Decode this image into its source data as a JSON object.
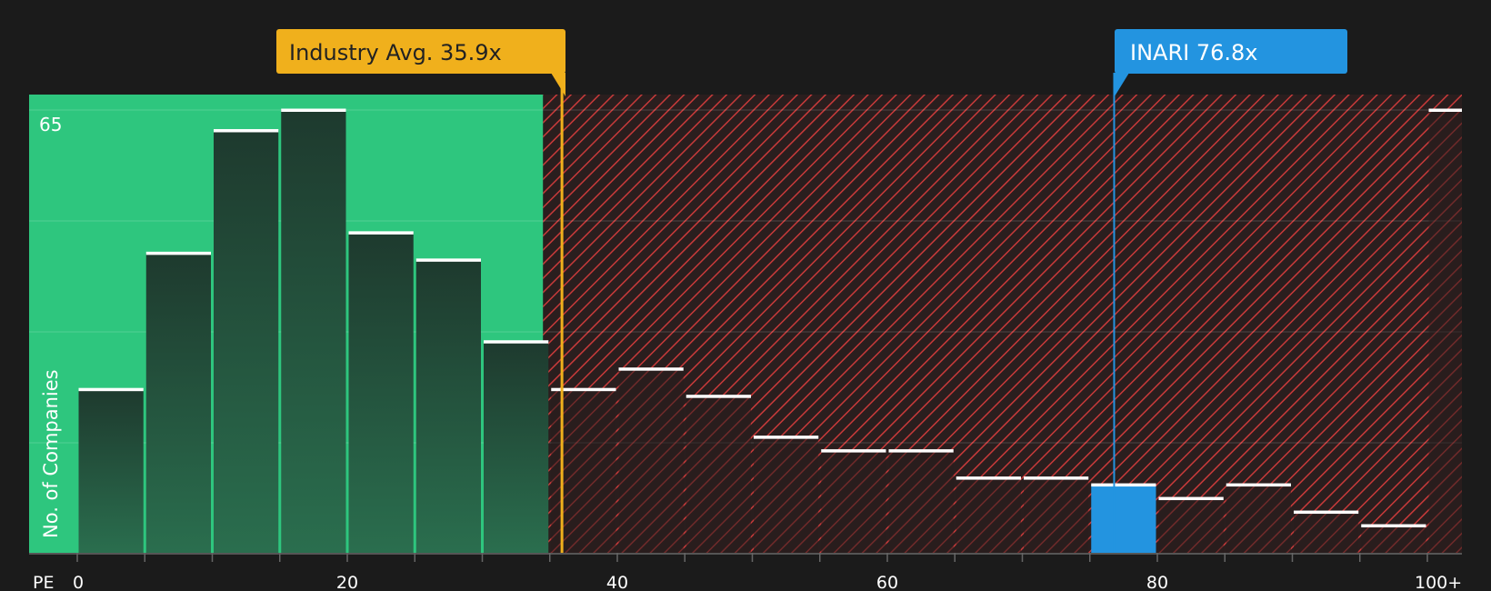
{
  "chart_data": {
    "type": "bar",
    "x_tick_prefix": "PE",
    "x_ticks": [
      "0",
      "20",
      "40",
      "60",
      "80",
      "100+"
    ],
    "y_tick_top": "65",
    "ylabel": "No. of Companies",
    "bins": [
      {
        "range": [
          0,
          5
        ],
        "value": 24,
        "highlight": false
      },
      {
        "range": [
          5,
          10
        ],
        "value": 44,
        "highlight": false
      },
      {
        "range": [
          10,
          15
        ],
        "value": 62,
        "highlight": false
      },
      {
        "range": [
          15,
          20
        ],
        "value": 65,
        "highlight": false
      },
      {
        "range": [
          20,
          25
        ],
        "value": 47,
        "highlight": false
      },
      {
        "range": [
          25,
          30
        ],
        "value": 43,
        "highlight": false
      },
      {
        "range": [
          30,
          35
        ],
        "value": 31,
        "highlight": false
      },
      {
        "range": [
          35,
          40
        ],
        "value": 24,
        "highlight": false
      },
      {
        "range": [
          40,
          45
        ],
        "value": 27,
        "highlight": false
      },
      {
        "range": [
          45,
          50
        ],
        "value": 23,
        "highlight": false
      },
      {
        "range": [
          50,
          55
        ],
        "value": 17,
        "highlight": false
      },
      {
        "range": [
          55,
          60
        ],
        "value": 15,
        "highlight": false
      },
      {
        "range": [
          60,
          65
        ],
        "value": 15,
        "highlight": false
      },
      {
        "range": [
          65,
          70
        ],
        "value": 11,
        "highlight": false
      },
      {
        "range": [
          70,
          75
        ],
        "value": 11,
        "highlight": false
      },
      {
        "range": [
          75,
          80
        ],
        "value": 10,
        "highlight": true
      },
      {
        "range": [
          80,
          85
        ],
        "value": 8,
        "highlight": false
      },
      {
        "range": [
          85,
          90
        ],
        "value": 10,
        "highlight": false
      },
      {
        "range": [
          90,
          95
        ],
        "value": 6,
        "highlight": false
      },
      {
        "range": [
          95,
          100
        ],
        "value": 4,
        "highlight": false
      },
      {
        "range": [
          100,
          102
        ],
        "value": 65,
        "highlight": false
      }
    ],
    "industry_avg": {
      "label": "Industry Avg. 35.9x",
      "value": 35.9
    },
    "company": {
      "label": "INARI 76.8x",
      "value": 76.8
    },
    "good_zone_end": 34.5,
    "colors": {
      "background": "#1b1b1b",
      "good_zone": "#2ec67e",
      "bad_zone_base": "#2a1e1e",
      "bad_zone_hatch": "#c83a3a",
      "bar_dark": "#1e3a2e",
      "bar_light": "#2a6e4e",
      "highlight_bar": "#2394e0",
      "industry_marker": "#f0b01c",
      "company_marker": "#2394e0",
      "bar_cap": "#ffffff",
      "label_text": "#ffffff"
    }
  }
}
